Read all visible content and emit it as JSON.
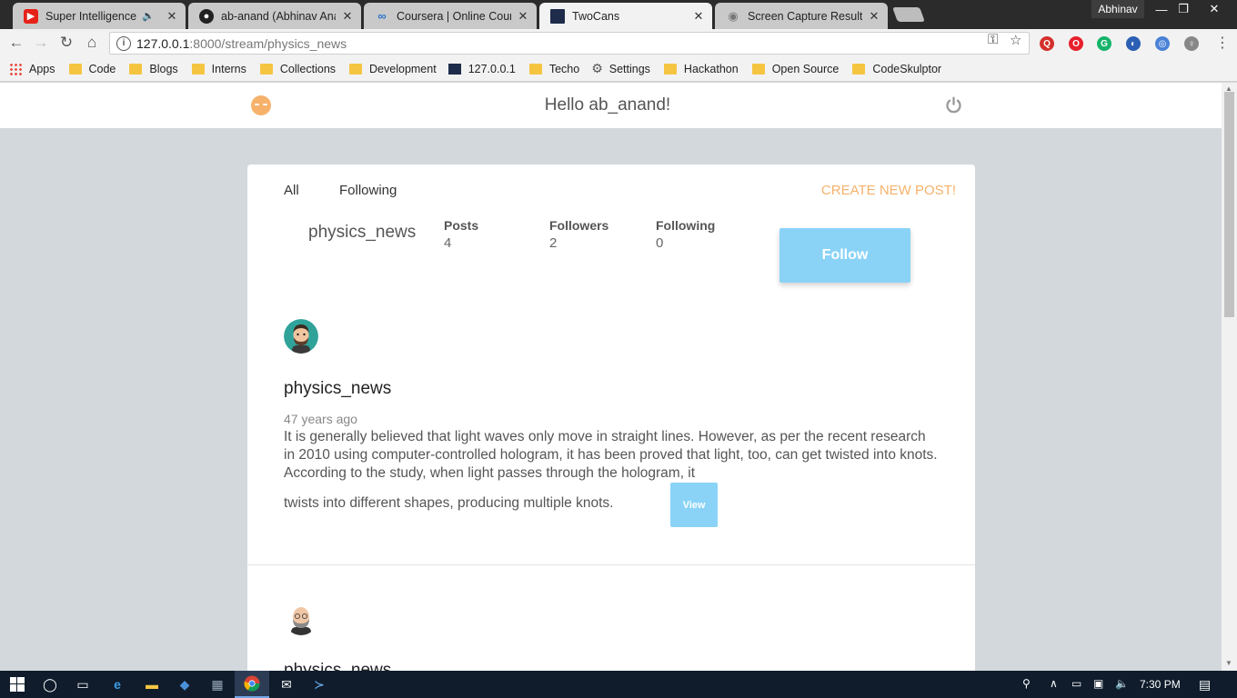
{
  "browser": {
    "tabs": [
      {
        "title": "Super Intelligence: Fo",
        "favicon": "youtube-icon",
        "audio": true
      },
      {
        "title": "ab-anand (Abhinav Anan",
        "favicon": "github-icon"
      },
      {
        "title": "Coursera | Online Course",
        "favicon": "coursera-icon"
      },
      {
        "title": "TwoCans",
        "favicon": "terminal-icon",
        "active": true
      },
      {
        "title": "Screen Capture Result",
        "favicon": "screen-capture-icon"
      }
    ],
    "profile_name": "Abhinav",
    "url_host": "127.0.0.1",
    "url_path": ":8000/stream/physics_news",
    "bookmarks": [
      {
        "label": "Apps",
        "icon": "apps-icon"
      },
      {
        "label": "Code",
        "icon": "folder-icon"
      },
      {
        "label": "Blogs",
        "icon": "folder-icon"
      },
      {
        "label": "Interns",
        "icon": "folder-icon"
      },
      {
        "label": "Collections",
        "icon": "folder-icon"
      },
      {
        "label": "Development",
        "icon": "folder-icon"
      },
      {
        "label": "127.0.0.1",
        "icon": "terminal-icon"
      },
      {
        "label": "Techo",
        "icon": "folder-icon"
      },
      {
        "label": "Settings",
        "icon": "gear-icon"
      },
      {
        "label": "Hackathon",
        "icon": "folder-icon"
      },
      {
        "label": "Open Source",
        "icon": "folder-icon"
      },
      {
        "label": "CodeSkulptor",
        "icon": "folder-icon"
      }
    ]
  },
  "app": {
    "greeting": "Hello ab_anand!",
    "accent_color": "#f6b26b",
    "button_color": "#8ad3f7"
  },
  "feed": {
    "tabs": [
      "All",
      "Following"
    ],
    "create_label": "CREATE NEW POST!"
  },
  "profile": {
    "username": "physics_news",
    "stats": [
      {
        "label": "Posts",
        "value": "4"
      },
      {
        "label": "Followers",
        "value": "2"
      },
      {
        "label": "Following",
        "value": "0"
      }
    ],
    "follow_label": "Follow"
  },
  "posts": [
    {
      "author": "physics_news",
      "time": "47 years ago",
      "body_main": "It is generally believed that light waves only move in straight lines. However, as per the recent research in 2010 using computer-controlled hologram, it has been proved that light, too, can get twisted into knots. According to the study, when light passes through the hologram, it",
      "body_last": "twists into different shapes, producing multiple knots.",
      "view_label": "View"
    },
    {
      "author": "physics_news"
    }
  ],
  "taskbar": {
    "time": "7:30 PM"
  }
}
